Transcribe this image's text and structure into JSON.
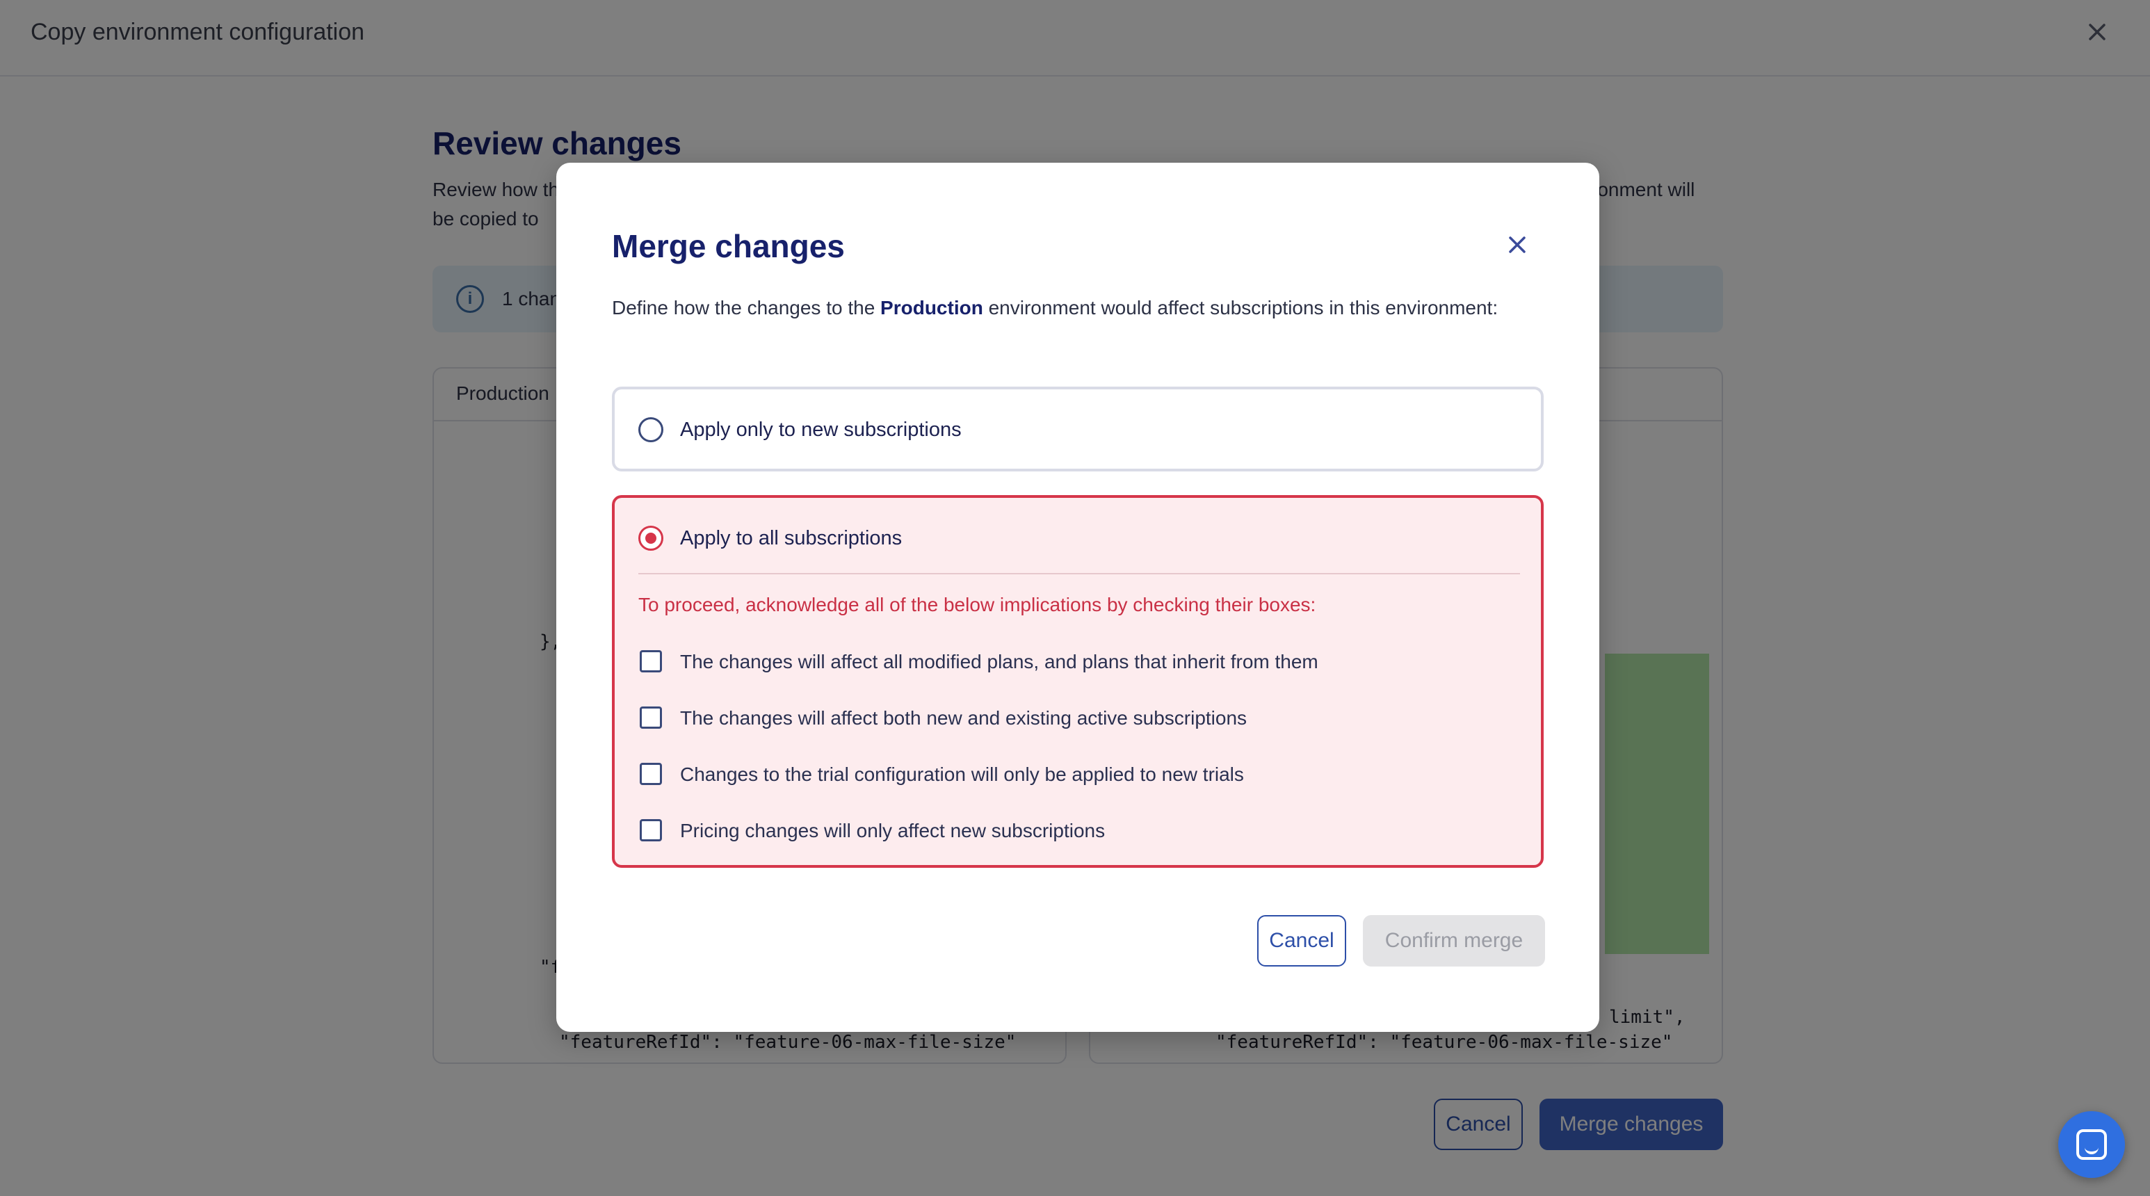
{
  "window": {
    "title": "Copy environment configuration",
    "close_icon": "close-icon"
  },
  "background": {
    "review_title": "Review changes",
    "review_desc_line1": "Review how th",
    "review_desc_line1_end": "ronment will",
    "review_desc_line2": "be copied to",
    "info_text": "1 chan",
    "left_panel_header": "Production",
    "code_left_1": "},",
    "code_left_2": "\"f",
    "code_left_3": "\"featureRefId\": \"feature-06-max-file-size\"",
    "code_right_1": "limit\",",
    "code_right_2": "\"featureRefId\": \"feature-06-max-file-size\"",
    "cancel_label": "Cancel",
    "merge_label": "Merge changes"
  },
  "modal": {
    "title": "Merge changes",
    "desc_prefix": "Define how the changes to the ",
    "desc_env": "Production",
    "desc_suffix": " environment would affect subscriptions in this environment:",
    "option_new": {
      "label": "Apply only to new subscriptions",
      "selected": false
    },
    "option_all": {
      "label": "Apply to all subscriptions",
      "selected": true,
      "warning": "To proceed, acknowledge all of the below implications by checking their boxes:",
      "checks": [
        {
          "label": "The changes will affect all modified plans, and plans that inherit from them",
          "checked": false
        },
        {
          "label": "The changes will affect both new and existing active subscriptions",
          "checked": false
        },
        {
          "label": "Changes to the trial configuration will only be applied to new trials",
          "checked": false
        },
        {
          "label": "Pricing changes will only affect new subscriptions",
          "checked": false
        }
      ]
    },
    "cancel_label": "Cancel",
    "confirm_label": "Confirm merge",
    "confirm_disabled": true
  },
  "chat": {
    "icon": "chat-icon"
  },
  "colors": {
    "title": "#17216b",
    "danger": "#d6364a",
    "danger_bg": "#fdecee",
    "primary": "#3f64c7",
    "diff_added": "#b3e6a8"
  }
}
